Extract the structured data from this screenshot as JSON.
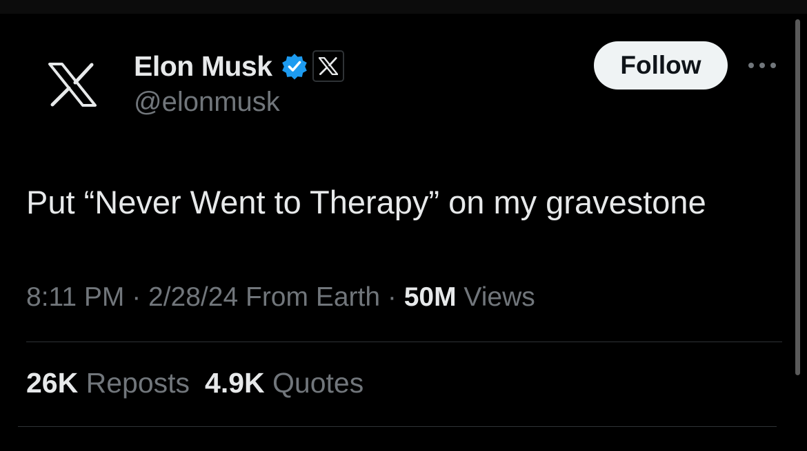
{
  "tweet": {
    "author": {
      "display_name": "Elon Musk",
      "handle": "@elonmusk",
      "avatar_icon": "x-logo-icon",
      "verified_icon": "verified-badge-icon",
      "affiliation_icon": "x-affiliation-icon"
    },
    "follow_label": "Follow",
    "more_icon": "more-options-icon",
    "text": "Put “Never Went to Therapy” on my gravestone",
    "meta": {
      "time": "8:11 PM",
      "sep1": " · ",
      "date": "2/28/24",
      "location": " From Earth",
      "sep2": " · ",
      "views_count": "50M",
      "views_label": " Views"
    },
    "stats": [
      {
        "count": "26K",
        "label": " Reposts"
      },
      {
        "count": "4.9K",
        "label": " Quotes"
      }
    ]
  },
  "colors": {
    "background": "#000000",
    "primary_text": "#e7e9ea",
    "secondary_text": "#71767b",
    "verified_blue": "#1d9bf0",
    "button_bg": "#eff3f4",
    "divider": "#2f3336"
  }
}
